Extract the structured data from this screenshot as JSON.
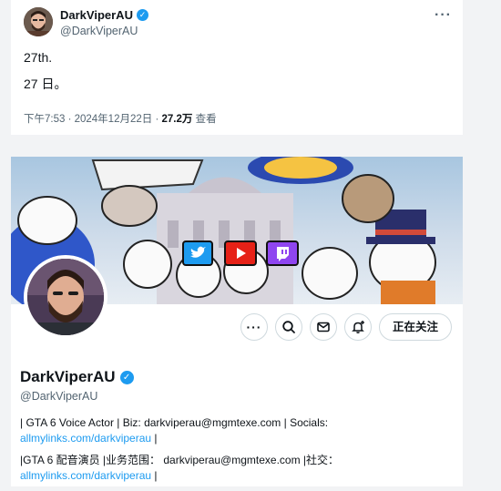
{
  "tweet": {
    "display_name": "DarkViperAU",
    "handle": "@DarkViperAU",
    "more_label": "···",
    "lines": [
      "27th.",
      "27 日。"
    ],
    "time": "下午7:53 · 2024年12月22日 · ",
    "views_count": "27.2万",
    "views_label": " 查看"
  },
  "profile": {
    "display_name": "DarkViperAU",
    "handle": "@DarkViperAU",
    "follow_label": "正在关注",
    "banner_icons": [
      "twitter-icon",
      "youtube-icon",
      "twitch-icon"
    ],
    "bio_en_line1": "| GTA 6 Voice Actor | Biz: darkviperau@mgmtexe.com | Socials:",
    "bio_en_link": "allmylinks.com/darkviperau",
    "bio_en_tail": " |",
    "bio_zh_line1": "|GTA 6 配音演员 |业务范围：  darkviperau@mgmtexe.com |社交：",
    "bio_zh_link": "allmylinks.com/darkviperau",
    "bio_zh_tail": " |"
  },
  "colors": {
    "accent": "#1d9bf0",
    "text": "#0f1419",
    "muted": "#536471",
    "page_bg": "#f2f3f5"
  }
}
